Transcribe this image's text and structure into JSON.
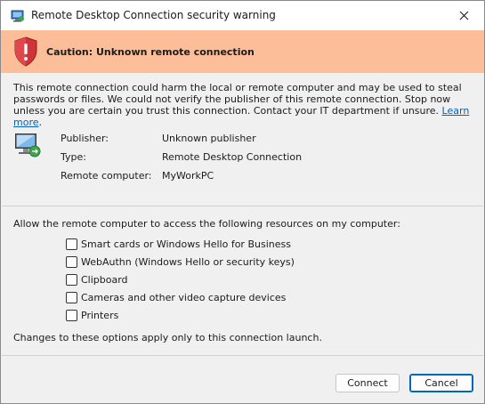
{
  "window": {
    "title": "Remote Desktop Connection security warning"
  },
  "banner": {
    "title": "Caution: Unknown remote connection"
  },
  "description": {
    "text": "This remote connection could harm the local or remote computer and may be used to steal passwords or files. We could not verify the publisher of this remote connection. Stop now unless you are certain you trust this connection. Contact your IT department if unsure.",
    "link": "Learn more",
    "end": "."
  },
  "info": [
    {
      "label": "Publisher:",
      "value": "Unknown publisher"
    },
    {
      "label": "Type:",
      "value": "Remote Desktop Connection"
    },
    {
      "label": "Remote computer:",
      "value": "MyWorkPC"
    }
  ],
  "resources": {
    "prompt": "Allow the remote computer to access the following resources on my computer:",
    "items": [
      {
        "label": "Smart cards or Windows Hello for Business",
        "checked": false
      },
      {
        "label": "WebAuthn (Windows Hello or security keys)",
        "checked": false
      },
      {
        "label": "Clipboard",
        "checked": false
      },
      {
        "label": "Cameras and other video capture devices",
        "checked": false
      },
      {
        "label": "Printers",
        "checked": false
      }
    ],
    "note": "Changes to these options apply only to this connection launch."
  },
  "buttons": {
    "connect": "Connect",
    "cancel": "Cancel"
  },
  "icons": {
    "app": "remote-desktop-icon",
    "warning": "shield-warning-icon",
    "computer": "remote-computer-icon",
    "close": "close-icon"
  },
  "colors": {
    "banner": "#fbbe98",
    "shield": "#d13438",
    "link": "#0a5eb8",
    "default_button_border": "#0067c0"
  }
}
